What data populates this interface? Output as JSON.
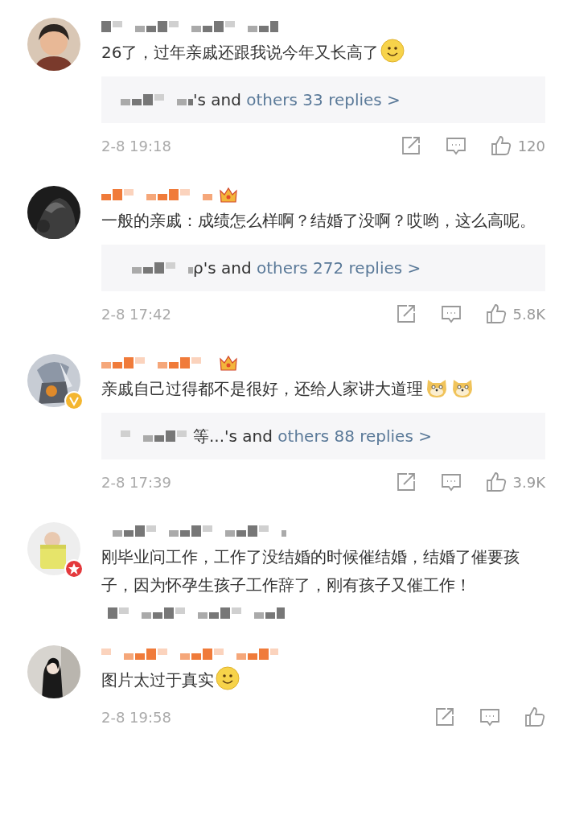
{
  "comments": [
    {
      "vip": false,
      "crown": false,
      "verified": false,
      "star_badge": false,
      "text": "26了，过年亲戚还跟我说今年又长高了",
      "emojis": [
        {
          "kind": "smile"
        }
      ],
      "trailing_redacted": false,
      "replies": {
        "lead": "'s and ",
        "link": "others 33 replies >"
      },
      "footer": {
        "time": "2-8 19:18",
        "likes": "120"
      }
    },
    {
      "vip": true,
      "crown": true,
      "verified": false,
      "star_badge": false,
      "text": "一般的亲戚：成绩怎么样啊？结婚了没啊？哎哟，这么高呢。",
      "trailing_redacted": false,
      "replies": {
        "lead": "ρ's and ",
        "link": "others 272 replies >"
      },
      "footer": {
        "time": "2-8 17:42",
        "likes": "5.8K"
      }
    },
    {
      "vip": true,
      "crown": true,
      "verified": true,
      "star_badge": false,
      "text": "亲戚自己过得都不是很好，还给人家讲大道理",
      "emojis": [
        {
          "kind": "doge"
        },
        {
          "kind": "doge"
        }
      ],
      "trailing_redacted": false,
      "replies": {
        "lead": "等...'s and ",
        "link": "others 88 replies >"
      },
      "footer": {
        "time": "2-8 17:39",
        "likes": "3.9K"
      }
    },
    {
      "vip": false,
      "crown": false,
      "verified": false,
      "star_badge": true,
      "text": "刚毕业问工作，工作了没结婚的时候催结婚，结婚了催要孩子，因为怀孕生孩子工作辞了，刚有孩子又催工作！",
      "trailing_redacted": true
    },
    {
      "vip": true,
      "crown": false,
      "verified": false,
      "star_badge": false,
      "text": "图片太过于真实",
      "emojis": [
        {
          "kind": "smile"
        }
      ],
      "trailing_redacted": false,
      "footer": {
        "time": "2-8 19:58"
      }
    }
  ]
}
